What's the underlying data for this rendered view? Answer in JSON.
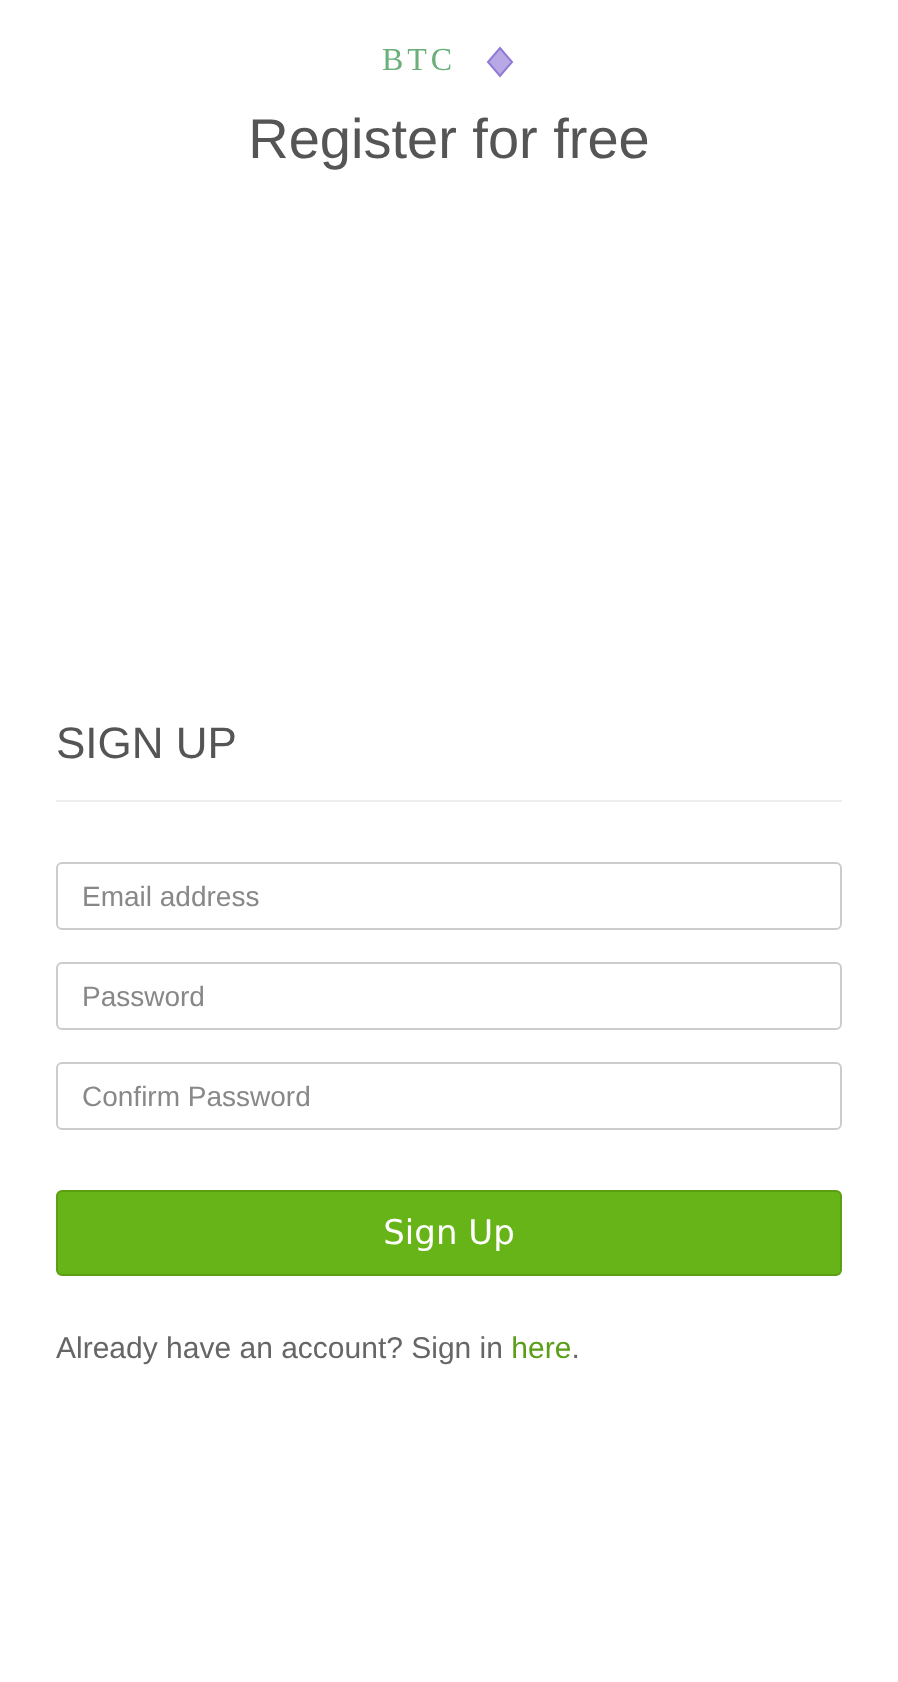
{
  "logo": {
    "text": "BTC"
  },
  "title": "Register for free",
  "form": {
    "heading": "SIGN UP",
    "fields": [
      {
        "placeholder": "Email address"
      },
      {
        "placeholder": "Password"
      },
      {
        "placeholder": "Confirm Password"
      }
    ],
    "submit": "Sign Up",
    "footer": {
      "before": "Already have an account? Sign in ",
      "link": "here",
      "after": "."
    }
  }
}
